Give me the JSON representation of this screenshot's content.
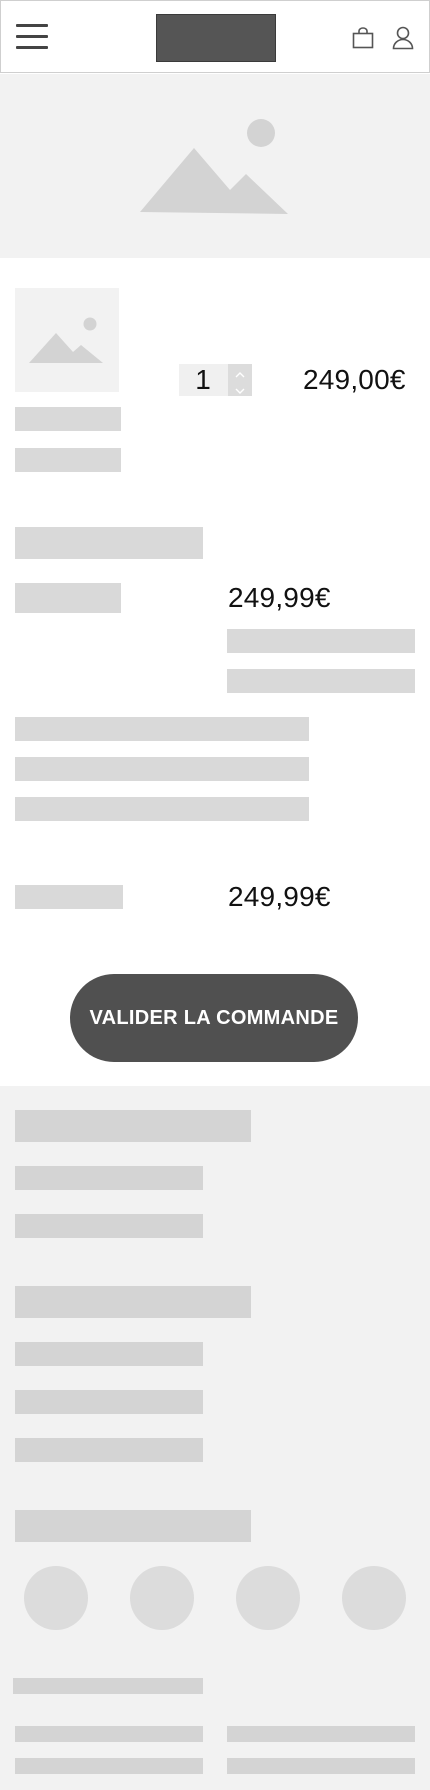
{
  "header": {
    "menu_icon": "hamburger-menu-icon",
    "logo": "logo-placeholder",
    "cart_icon": "shopping-bag-icon",
    "account_icon": "user-icon"
  },
  "hero": {
    "image_icon": "image-placeholder-icon"
  },
  "cart_item": {
    "image_icon": "image-placeholder-icon",
    "quantity": "1",
    "price": "249,00€"
  },
  "summary": {
    "subtotal_price": "249,99€",
    "total_price": "249,99€"
  },
  "checkout_button_label": "VALIDER LA COMMANDE",
  "colors": {
    "placeholder": "#d9d9d9",
    "background_light": "#f2f2f2",
    "button": "#505050"
  }
}
